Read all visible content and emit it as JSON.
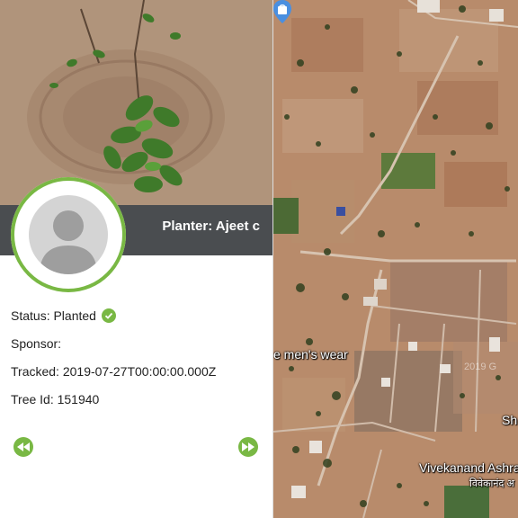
{
  "planter": {
    "label": "Planter: Ajeet c"
  },
  "tree": {
    "status_label": "Status: Planted",
    "sponsor_label": "Sponsor:",
    "tracked_label": "Tracked: 2019-07-27T00:00:00.000Z",
    "tree_id_label": "Tree Id: 151940"
  },
  "nav": {
    "prev_icon": "rewind-icon",
    "next_icon": "fast-forward-icon"
  },
  "map": {
    "labels": {
      "shop": "e men's wear",
      "place": "Vivekanand Ashra",
      "place_hindi": "विवेकानंद अ",
      "partial": "Sh",
      "imagery_year": "2019 G"
    }
  },
  "colors": {
    "accent": "#79b844",
    "bar": "#4a4d50"
  }
}
